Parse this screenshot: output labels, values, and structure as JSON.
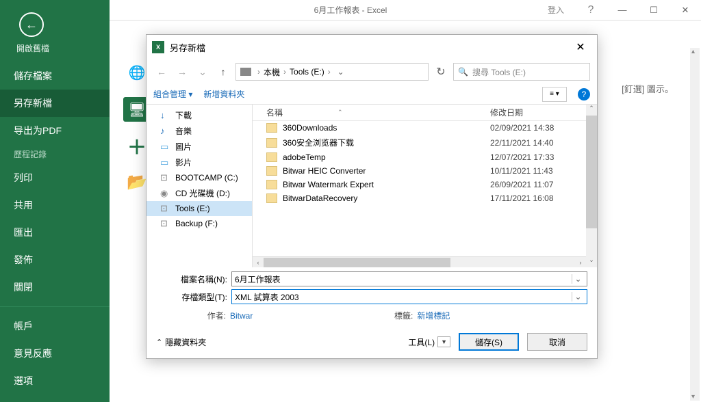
{
  "window": {
    "title": "6月工作報表 - Excel",
    "login": "登入"
  },
  "sidebar": {
    "back_title": "開啟舊檔",
    "items": [
      "儲存檔案",
      "另存新檔",
      "导出为PDF",
      "列印",
      "共用",
      "匯出",
      "發佈",
      "關閉",
      "帳戶",
      "意見反應",
      "選項"
    ],
    "history_label": "歷程記錄"
  },
  "content": {
    "hint": "[釘選] 圖示。"
  },
  "dialog": {
    "title": "另存新檔",
    "breadcrumb": {
      "root": "本機",
      "drive": "Tools (E:)"
    },
    "search_placeholder": "搜尋 Tools (E:)",
    "toolbar": {
      "organize": "組合管理 ▾",
      "new_folder": "新增資料夾"
    },
    "tree": [
      {
        "icon": "↓",
        "label": "下載",
        "color": "#1a6bb8"
      },
      {
        "icon": "♪",
        "label": "音樂",
        "color": "#1a6bb8"
      },
      {
        "icon": "▭",
        "label": "圖片",
        "color": "#4aa3df"
      },
      {
        "icon": "▭",
        "label": "影片",
        "color": "#4aa3df"
      },
      {
        "icon": "⊡",
        "label": "BOOTCAMP (C:)",
        "color": "#888"
      },
      {
        "icon": "◉",
        "label": "CD 光碟機 (D:)",
        "color": "#888"
      },
      {
        "icon": "⊡",
        "label": "Tools (E:)",
        "color": "#888",
        "selected": true
      },
      {
        "icon": "⊡",
        "label": "Backup (F:)",
        "color": "#888"
      }
    ],
    "columns": {
      "name": "名稱",
      "date": "修改日期"
    },
    "files": [
      {
        "name": "360Downloads",
        "date": "02/09/2021 14:38"
      },
      {
        "name": "360安全浏览器下载",
        "date": "22/11/2021 14:40"
      },
      {
        "name": "adobeTemp",
        "date": "12/07/2021 17:33"
      },
      {
        "name": "Bitwar HEIC Converter",
        "date": "10/11/2021 11:43"
      },
      {
        "name": "Bitwar Watermark Expert",
        "date": "26/09/2021 11:07"
      },
      {
        "name": "BitwarDataRecovery",
        "date": "17/11/2021 16:08"
      }
    ],
    "filename_label": "檔案名稱(N):",
    "filename_value": "6月工作報表",
    "filetype_label": "存檔類型(T):",
    "filetype_value": "XML 試算表 2003",
    "author_label": "作者:",
    "author_value": "Bitwar",
    "tags_label": "標籤:",
    "tags_value": "新增標記",
    "hide_folders": "隱藏資料夾",
    "tools_label": "工具(L)",
    "save_btn": "儲存(S)",
    "cancel_btn": "取消"
  }
}
